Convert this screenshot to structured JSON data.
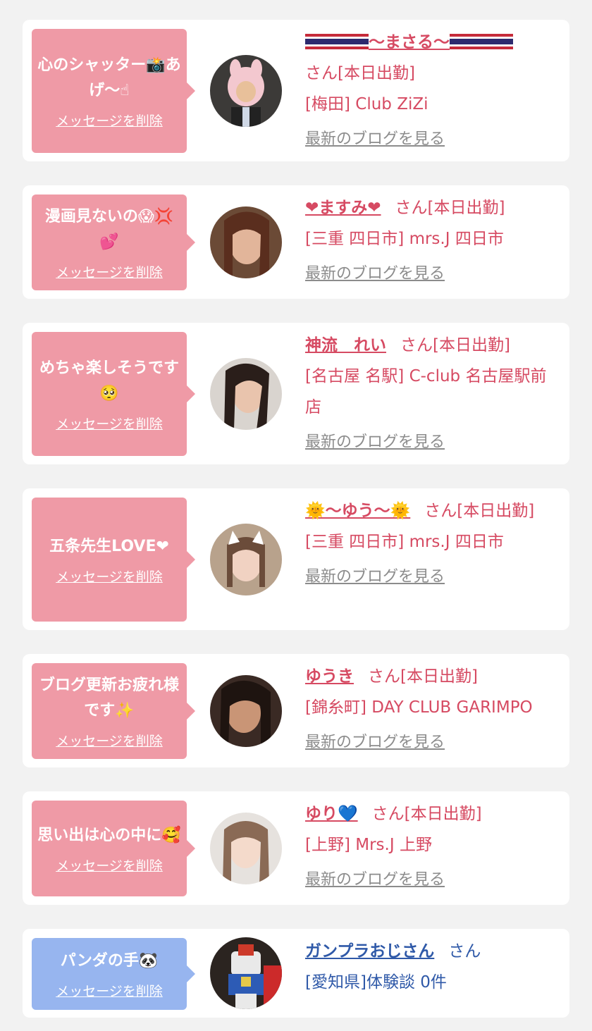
{
  "common": {
    "delete_label": "メッセージを削除",
    "blog_label": "最新のブログを見る"
  },
  "colors": {
    "pink_bubble": "#ef9aa6",
    "blue_bubble": "#97b5ef",
    "name_pink": "#d64a62",
    "name_blue": "#2f59a8",
    "link_gray": "#8c8c8c"
  },
  "cards": [
    {
      "message": "心のシャッター📸あげ〜☝",
      "name": "〜まさる〜",
      "name_icon": "thai-flag-icon",
      "suffix": "さん[本日出勤]",
      "shop": "[梅田] Club ZiZi",
      "avatar": "pig-costume-photo"
    },
    {
      "message": "漫画見ないの😱💢💕",
      "name": "❤ますみ❤",
      "suffix": "さん[本日出勤]",
      "shop": "[三重 四日市] mrs.J 四日市",
      "avatar": "woman-photo"
    },
    {
      "message": "めちゃ楽しそうです🥺",
      "name": "神流　れい",
      "suffix": "さん[本日出勤]",
      "shop": "[名古屋 名駅] C-club 名古屋駅前店",
      "avatar": "woman-photo"
    },
    {
      "message": "五条先生LOVE❤",
      "name": "🌞〜ゆう〜🌞",
      "suffix": "さん[本日出勤]",
      "shop": "[三重 四日市] mrs.J 四日市",
      "avatar": "cat-ears-photo"
    },
    {
      "message": "ブログ更新お疲れ様です✨",
      "name": "ゆうき",
      "suffix": "さん[本日出勤]",
      "shop": "[錦糸町] DAY CLUB GARIMPO",
      "avatar": "woman-photo"
    },
    {
      "message": "思い出は心の中に🥰",
      "name": "ゆり💙",
      "suffix": "さん[本日出勤]",
      "shop": "[上野] Mrs.J 上野",
      "avatar": "woman-photo"
    },
    {
      "message": "パンダの手🐼",
      "name": "ガンプラおじさん",
      "suffix": "さん",
      "shop": "[愛知県]体験談 0件",
      "avatar": "gundam-model-photo"
    }
  ]
}
